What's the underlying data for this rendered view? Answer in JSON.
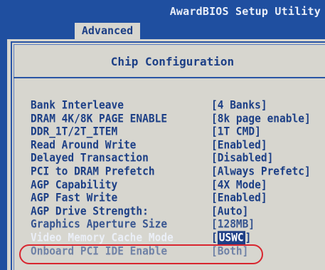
{
  "app_title": "AwardBIOS Setup Utility",
  "tab": {
    "label": "Advanced"
  },
  "section_title": "Chip Configuration",
  "colors": {
    "header_blue": "#1f4fa0",
    "text_blue": "#1c3f86",
    "background": "#d7d6cf",
    "highlight_red": "#d8262f"
  },
  "settings": [
    {
      "label": "Bank Interleave",
      "value": "[4 Banks]"
    },
    {
      "label": "DRAM 4K/8K PAGE ENABLE",
      "value": "[8k page enable]"
    },
    {
      "label": "DDR_1T/2T_ITEM",
      "value": "[1T CMD]"
    },
    {
      "label": "Read Around Write",
      "value": "[Enabled]"
    },
    {
      "label": "Delayed Transaction",
      "value": "[Disabled]"
    },
    {
      "label": "PCI to DRAM Prefetch",
      "value": "[Always Prefetc]"
    },
    {
      "label": "AGP Capability",
      "value": "[4X Mode]"
    },
    {
      "label": "AGP Fast Write",
      "value": "[Enabled]"
    },
    {
      "label": "AGP Drive Strength:",
      "value": "[Auto]"
    },
    {
      "label": "Graphics Aperture Size",
      "value": "[128MB]"
    },
    {
      "label": "Video Memory Cache Mode",
      "value_open": "[",
      "value": "USWC",
      "value_close": "]"
    },
    {
      "label": "Onboard PCI IDE Enable",
      "value": "[Both]"
    }
  ]
}
